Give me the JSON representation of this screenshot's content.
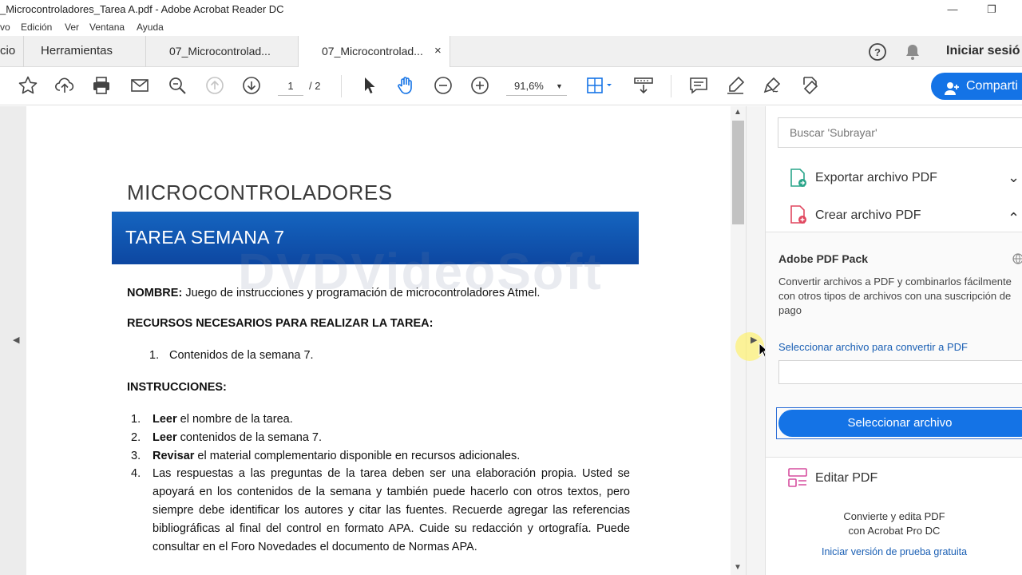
{
  "window": {
    "title": "_Microcontroladores_Tarea A.pdf - Adobe Acrobat Reader DC",
    "minimize_glyph": "—",
    "restore_glyph": "❐"
  },
  "menu": [
    "vo",
    "Edición",
    "Ver",
    "Ventana",
    "Ayuda"
  ],
  "tabs": {
    "home": "cio",
    "tools": "Herramientas",
    "doc1": "07_Microcontrolad...",
    "doc2": "07_Microcontrolad...",
    "close_glyph": "×",
    "signin": "Iniciar sesió"
  },
  "toolbar": {
    "page_current": "1",
    "page_total": "/  2",
    "zoom": "91,6%",
    "share_label": "Comparti"
  },
  "document": {
    "heading": "MICROCONTROLADORES",
    "banner": "TAREA SEMANA 7",
    "watermark": "DVDVideoSoft",
    "nombre_label": "NOMBRE:",
    "nombre_value": "Juego de instrucciones y programación de microcontroladores Atmel.",
    "recursos_label": "RECURSOS NECESARIOS PARA REALIZAR LA TAREA:",
    "recursos_items": [
      "1.",
      "Contenidos de la semana 7."
    ],
    "instrucciones_label": "INSTRUCCIONES:",
    "steps": [
      {
        "num": "1.",
        "bold": "Leer",
        "text": " el nombre de la tarea."
      },
      {
        "num": "2.",
        "bold": "Leer",
        "text": " contenidos de la semana 7."
      },
      {
        "num": "3.",
        "bold": "Revisar",
        "text": " el material complementario disponible en recursos adicionales."
      },
      {
        "num": "4.",
        "bold": "",
        "text": ""
      }
    ],
    "step4_paragraph": "Las respuestas a las preguntas de la tarea deben ser una elaboración propia. Usted se apoyará en los contenidos de la semana y también puede hacerlo con otros textos, pero siempre debe identificar los autores y citar las fuentes. Recuerde agregar las referencias bibliográficas al final del control en formato APA. Cuide su redacción y ortografía. Puede consultar en el Foro Novedades el documento de Normas APA."
  },
  "right_panel": {
    "search_placeholder": "Buscar 'Subrayar'",
    "export_label": "Exportar archivo PDF",
    "create_label": "Crear archivo PDF",
    "pack_title": "Adobe PDF Pack",
    "pack_desc": "Convertir archivos a PDF y combinarlos fácilmente con otros tipos de archivos con una suscripción de pago",
    "select_link": "Seleccionar archivo para convertir a PDF",
    "select_button": "Seleccionar archivo",
    "edit_label": "Editar PDF",
    "promo_line1": "Convierte y edita PDF",
    "promo_line2": "con Acrobat Pro DC",
    "trial_link": "Iniciar versión de prueba gratuita",
    "export_chevron": "⌄",
    "create_chevron": "⌃"
  },
  "colors": {
    "accent": "#1473e6",
    "banner": "#1565c0",
    "link": "#1a5fb4"
  }
}
